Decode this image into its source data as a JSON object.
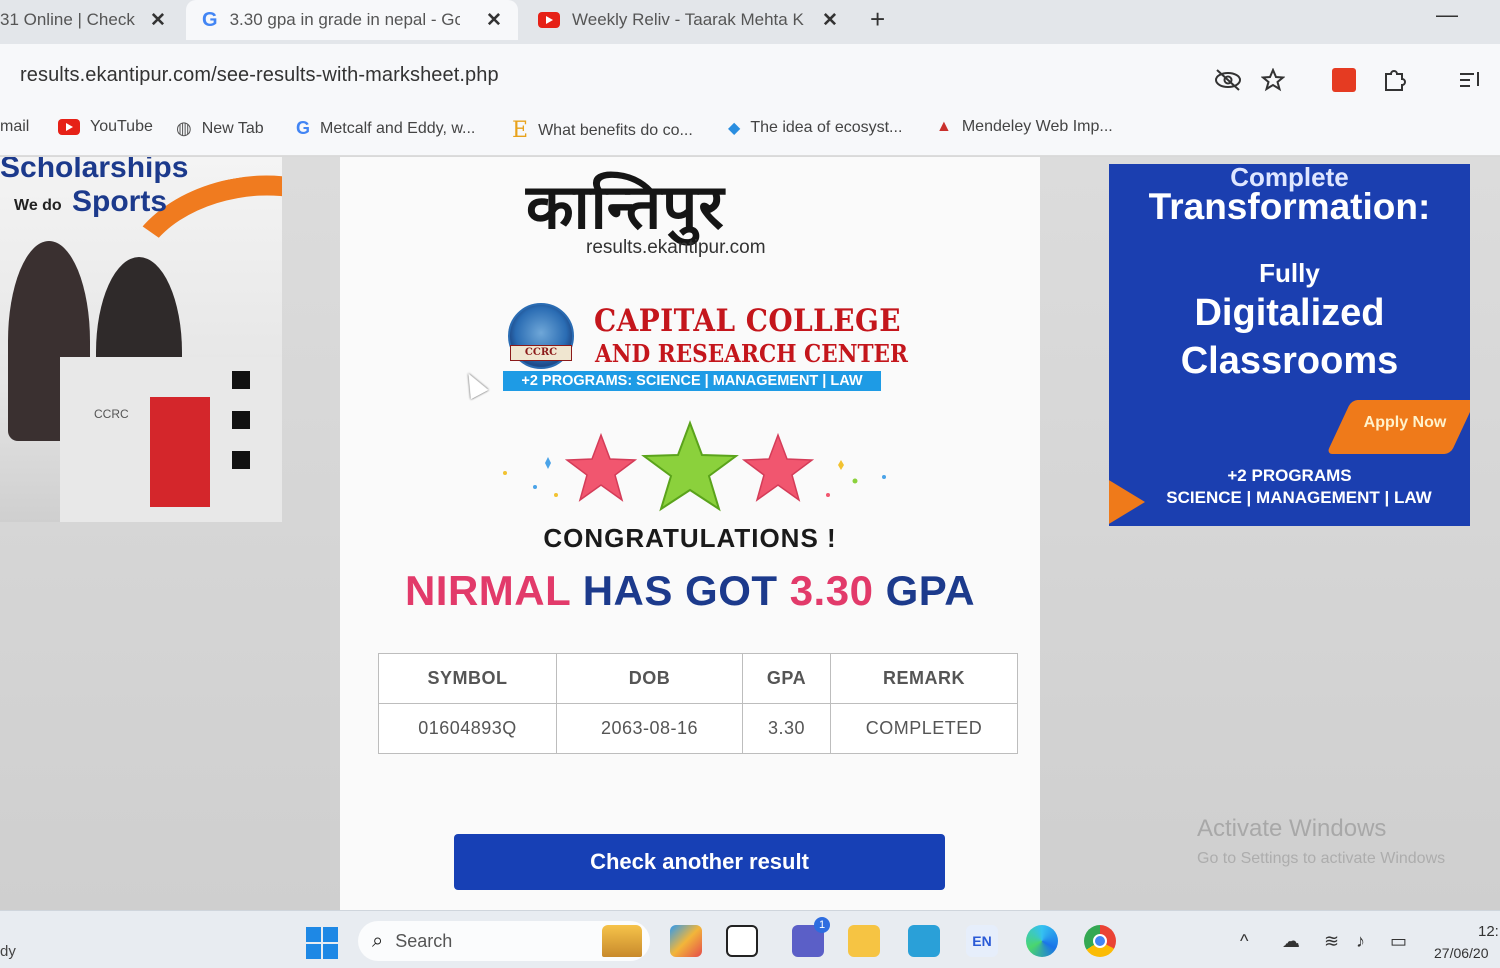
{
  "browser": {
    "tabs": [
      {
        "title": "31 Online | Check",
        "icon": "generic-page-icon"
      },
      {
        "title": "3.30 gpa in grade in nepal - Go",
        "icon": "google-icon"
      },
      {
        "title": "Weekly Reliv - Taarak Mehta Ka",
        "icon": "youtube-icon"
      }
    ],
    "close_glyph": "✕",
    "new_tab_glyph": "+",
    "minimize_glyph": "—",
    "url": "results.ekantipur.com/see-results-with-marksheet.php",
    "address_icons": [
      "eye-off-icon",
      "star-icon",
      "extension-red-icon",
      "puzzle-icon",
      "reading-list-icon"
    ],
    "bookmarks": [
      {
        "label": "mail",
        "icon": "gmail-icon"
      },
      {
        "label": "YouTube",
        "icon": "youtube-icon"
      },
      {
        "label": "New Tab",
        "icon": "globe-icon"
      },
      {
        "label": "Metcalf and Eddy, w...",
        "icon": "google-icon"
      },
      {
        "label": "What benefits do co...",
        "icon": "e-letter-icon"
      },
      {
        "label": "The idea of ecosyst...",
        "icon": "diamond-icon"
      },
      {
        "label": "Mendeley Web Imp...",
        "icon": "mendeley-icon"
      }
    ]
  },
  "left_ad": {
    "line1": "Scholarships",
    "we_do": "We do",
    "sports": "Sports",
    "building_sign": "CCRC"
  },
  "result_page": {
    "logo_text": "कान्तिपुर",
    "site": "results.ekantipur.com",
    "college": {
      "name_line1": "CAPITAL COLLEGE",
      "name_line2": "AND RESEARCH CENTER",
      "emblem_text": "CCRC",
      "programs": "+2 PROGRAMS: SCIENCE | MANAGEMENT | LAW"
    },
    "congrats": "CONGRATULATIONS !",
    "headline": {
      "name": "NIRMAL",
      "mid": "HAS GOT",
      "gpa": "3.30",
      "tail": "GPA"
    },
    "table": {
      "headers": [
        "SYMBOL",
        "DOB",
        "GPA",
        "REMARK"
      ],
      "row": [
        "01604893Q",
        "2063-08-16",
        "3.30",
        "COMPLETED"
      ]
    },
    "button": "Check another result"
  },
  "right_ad": {
    "line1": "Complete",
    "line2": "Transformation:",
    "line3": "Fully",
    "line4": "Digitalized",
    "line5": "Classrooms",
    "apply": "Apply Now",
    "line6": "+2 PROGRAMS",
    "line7": "SCIENCE | MANAGEMENT | LAW"
  },
  "windows_watermark": {
    "line1": "Activate Windows",
    "line2": "Go to Settings to activate Windows"
  },
  "taskbar": {
    "left_text": "dy",
    "search_placeholder": "Search",
    "lang": "EN",
    "time": "12:",
    "date": "27/06/20",
    "notification_count": "1"
  },
  "colors": {
    "brand_blue": "#1c3a8c",
    "accent_pink": "#e23a6a",
    "college_red": "#c4161c",
    "button_blue": "#1740b5",
    "ad_blue": "#1b3fb0",
    "ad_orange": "#ef7a1a"
  }
}
